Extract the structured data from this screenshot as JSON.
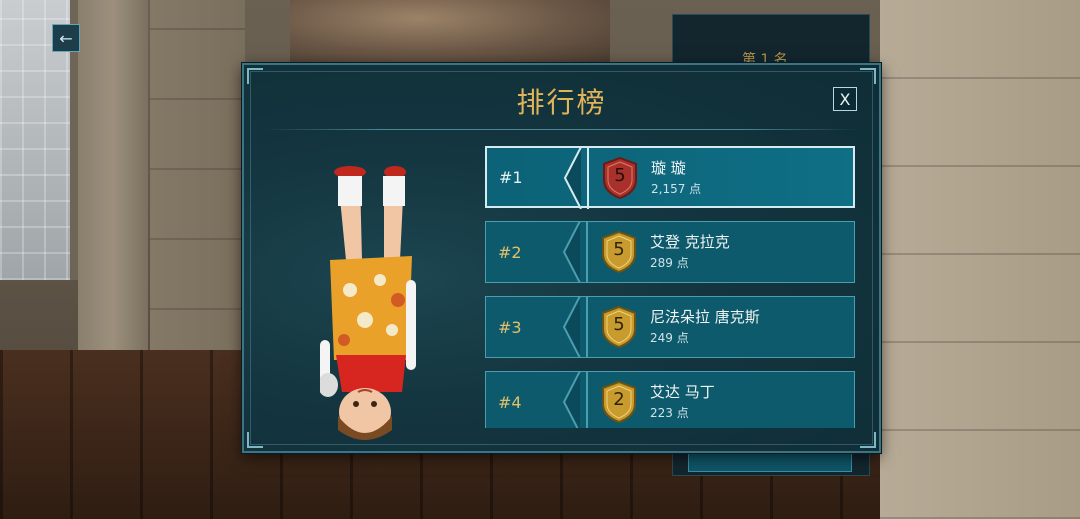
{
  "background": {
    "panel_text": "第 1 名"
  },
  "leaderboard": {
    "title": "排行榜",
    "close_label": "X",
    "back_label": "←",
    "entries": [
      {
        "rank": "#1",
        "level": "5",
        "name": "璇 璇",
        "points": "2,157 点",
        "badge_color": "#a8322b",
        "highlighted": true
      },
      {
        "rank": "#2",
        "level": "5",
        "name": "艾登 克拉克",
        "points": "289 点",
        "badge_color": "#c79b2e",
        "highlighted": false
      },
      {
        "rank": "#3",
        "level": "5",
        "name": "尼法朵拉 唐克斯",
        "points": "249 点",
        "badge_color": "#c79b2e",
        "highlighted": false
      },
      {
        "rank": "#4",
        "level": "2",
        "name": "艾达 马丁",
        "points": "223 点",
        "badge_color": "#c79b2e",
        "highlighted": false
      }
    ]
  },
  "colors": {
    "title_gold": "#e2b45a",
    "row_teal": "#0d5a6c",
    "row_border": "#4b9db0"
  }
}
